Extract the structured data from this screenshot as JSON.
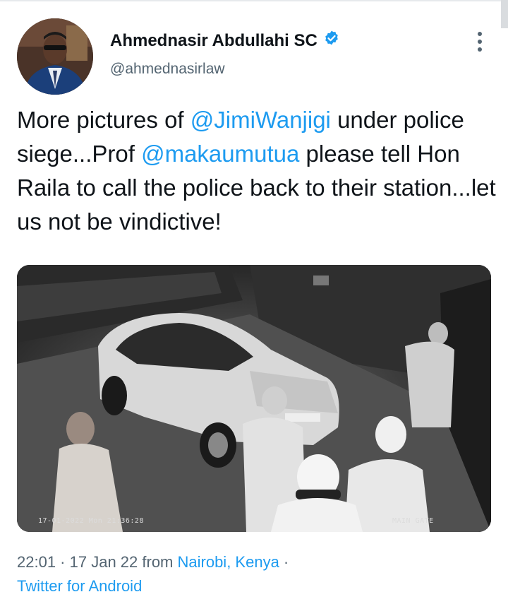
{
  "author": {
    "display_name": "Ahmednasir Abdullahi SC",
    "handle": "@ahmednasirlaw",
    "verified": true,
    "verified_color": "#1d9bf0"
  },
  "tweet": {
    "text_1": "More pictures of ",
    "mention_1": "@JimiWanjigi",
    "text_2": " under police siege...Prof ",
    "mention_2": "@makaumutua",
    "text_3": " please tell Hon Raila to call the police back to their station...let us not be vindictive!"
  },
  "media": {
    "overlay_datetime": "17-01-2022 Mon 21:36:28",
    "overlay_camera": "MAIN GATE"
  },
  "meta": {
    "time": "22:01",
    "dot_1": " · ",
    "date": "17 Jan 22",
    "from_label": " from ",
    "location": "Nairobi, Kenya",
    "dot_2": " ·",
    "source": "Twitter for Android"
  },
  "colors": {
    "accent": "#1d9bf0",
    "secondary_text": "#536471",
    "primary_text": "#0f1419"
  },
  "icons": {
    "verified": "verified-badge-icon",
    "more": "more-vertical-icon"
  }
}
